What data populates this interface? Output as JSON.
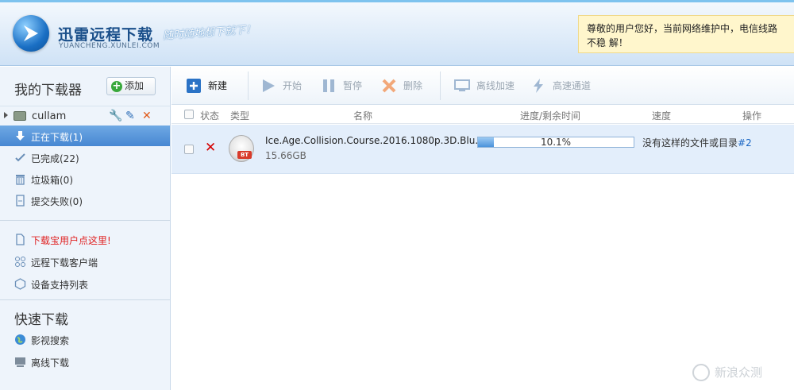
{
  "header": {
    "brand_title": "迅雷远程下载",
    "brand_sub": "YUANCHENG.XUNLEI.COM",
    "slogan": "随时随地想下就下！",
    "notice": "尊敬的用户您好，当前网络维护中，电信线路不稳 解！"
  },
  "sidebar": {
    "title": "我的下载器",
    "add_label": "添加",
    "device": {
      "name": "cullam"
    },
    "nav": [
      {
        "label": "正在下载(1)",
        "icon": "download-arrow-icon",
        "active": true
      },
      {
        "label": "已完成(22)",
        "icon": "check-icon"
      },
      {
        "label": "垃圾箱(0)",
        "icon": "trash-icon"
      },
      {
        "label": "提交失败(0)",
        "icon": "file-fail-icon"
      }
    ],
    "links": [
      {
        "label": "下载宝用户点这里!",
        "icon": "document-icon",
        "highlight": true
      },
      {
        "label": "远程下载客户端",
        "icon": "grid-icon"
      },
      {
        "label": "设备支持列表",
        "icon": "cube-icon"
      }
    ],
    "quick_title": "快速下载",
    "quick": [
      {
        "label": "影视搜索",
        "icon": "globe-icon"
      },
      {
        "label": "离线下载",
        "icon": "offline-icon"
      }
    ]
  },
  "toolbar": {
    "new": "新建",
    "start": "开始",
    "pause": "暂停",
    "delete": "删除",
    "offline_accel": "离线加速",
    "high_speed": "高速通道"
  },
  "columns": {
    "status": "状态",
    "type": "类型",
    "name": "名称",
    "progress": "进度/剩余时间",
    "speed": "速度",
    "action": "操作"
  },
  "task": {
    "name": "Ice.Age.Collision.Course.2016.1080p.3D.Blu...",
    "size": "15.66GB",
    "progress_text": "10.1%",
    "progress": 0.101,
    "type_badge": "BT",
    "status_text": "没有这样的文件或目录",
    "status_code": "#2"
  },
  "watermark": "新浪众测"
}
